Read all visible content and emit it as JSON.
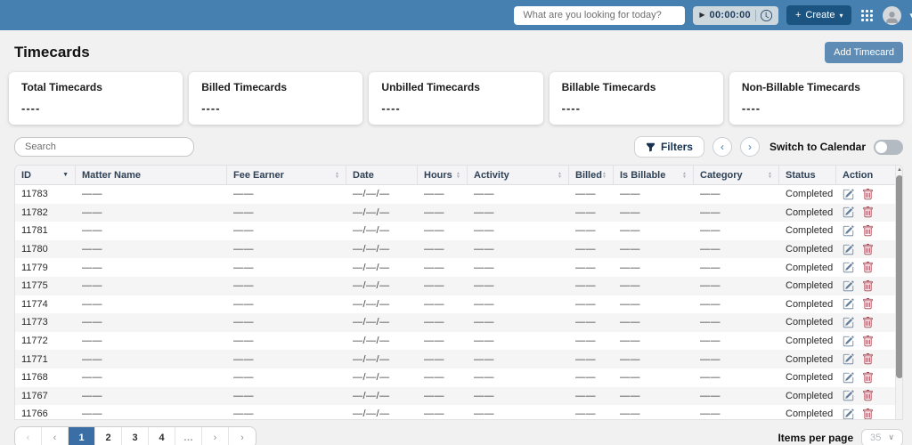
{
  "icons": {
    "plus": "+",
    "caret_down": "▾",
    "play": "▶",
    "chevron_left": "‹",
    "chevron_right": "›",
    "sort_caret": "▼",
    "sort_up": "▲",
    "sort_down": "▼",
    "select_caret": "∨",
    "scroll_up": "▲"
  },
  "colors": {
    "topbar": "#4580b0",
    "create_button": "#1b5480",
    "add_button": "#5e8cb4",
    "active_page": "#3a6ea5",
    "edit_icon": "#647f9c",
    "delete_icon": "#a83a48"
  },
  "topbar": {
    "search_placeholder": "What are you looking for today?",
    "timer_time": "00:00:00",
    "create_label": "Create"
  },
  "page": {
    "title": "Timecards",
    "add_button_label": "Add Timecard"
  },
  "summary_cards": [
    {
      "label": "Total Timecards",
      "value": "----"
    },
    {
      "label": "Billed Timecards",
      "value": "----"
    },
    {
      "label": "Unbilled Timecards",
      "value": "----"
    },
    {
      "label": "Billable Timecards",
      "value": "----"
    },
    {
      "label": "Non-Billable Timecards",
      "value": "----"
    }
  ],
  "filters": {
    "search_placeholder": "Search",
    "filters_label": "Filters",
    "calendar_toggle_label": "Switch to Calendar",
    "toggle_state": "off"
  },
  "table": {
    "columns": [
      {
        "label": "ID",
        "sort": "caret"
      },
      {
        "label": "Matter Name",
        "sort": "none"
      },
      {
        "label": "Fee Earner",
        "sort": "updown"
      },
      {
        "label": "Date",
        "sort": "none"
      },
      {
        "label": "Hours",
        "sort": "updown"
      },
      {
        "label": "Activity",
        "sort": "updown"
      },
      {
        "label": "Billed",
        "sort": "updown"
      },
      {
        "label": "Is Billable",
        "sort": "updown"
      },
      {
        "label": "Category",
        "sort": "updown"
      },
      {
        "label": "Status",
        "sort": "none"
      },
      {
        "label": "Action",
        "sort": "none"
      }
    ],
    "field_order": [
      "id",
      "matter_name",
      "fee_earner",
      "date",
      "hours",
      "activity",
      "billed",
      "is_billable",
      "category",
      "status"
    ],
    "rows": [
      {
        "id": "11783",
        "matter_name": "——",
        "fee_earner": "——",
        "date": "—/—/—",
        "hours": "——",
        "activity": "——",
        "billed": "——",
        "is_billable": "——",
        "category": "——",
        "status": "Completed"
      },
      {
        "id": "11782",
        "matter_name": "——",
        "fee_earner": "——",
        "date": "—/—/—",
        "hours": "——",
        "activity": "——",
        "billed": "——",
        "is_billable": "——",
        "category": "——",
        "status": "Completed"
      },
      {
        "id": "11781",
        "matter_name": "——",
        "fee_earner": "——",
        "date": "—/—/—",
        "hours": "——",
        "activity": "——",
        "billed": "——",
        "is_billable": "——",
        "category": "——",
        "status": "Completed"
      },
      {
        "id": "11780",
        "matter_name": "——",
        "fee_earner": "——",
        "date": "—/—/—",
        "hours": "——",
        "activity": "——",
        "billed": "——",
        "is_billable": "——",
        "category": "——",
        "status": "Completed"
      },
      {
        "id": "11779",
        "matter_name": "——",
        "fee_earner": "——",
        "date": "—/—/—",
        "hours": "——",
        "activity": "——",
        "billed": "——",
        "is_billable": "——",
        "category": "——",
        "status": "Completed"
      },
      {
        "id": "11775",
        "matter_name": "——",
        "fee_earner": "——",
        "date": "—/—/—",
        "hours": "——",
        "activity": "——",
        "billed": "——",
        "is_billable": "——",
        "category": "——",
        "status": "Completed"
      },
      {
        "id": "11774",
        "matter_name": "——",
        "fee_earner": "——",
        "date": "—/—/—",
        "hours": "——",
        "activity": "——",
        "billed": "——",
        "is_billable": "——",
        "category": "——",
        "status": "Completed"
      },
      {
        "id": "11773",
        "matter_name": "——",
        "fee_earner": "——",
        "date": "—/—/—",
        "hours": "——",
        "activity": "——",
        "billed": "——",
        "is_billable": "——",
        "category": "——",
        "status": "Completed"
      },
      {
        "id": "11772",
        "matter_name": "——",
        "fee_earner": "——",
        "date": "—/—/—",
        "hours": "——",
        "activity": "——",
        "billed": "——",
        "is_billable": "——",
        "category": "——",
        "status": "Completed"
      },
      {
        "id": "11771",
        "matter_name": "——",
        "fee_earner": "——",
        "date": "—/—/—",
        "hours": "——",
        "activity": "——",
        "billed": "——",
        "is_billable": "——",
        "category": "——",
        "status": "Completed"
      },
      {
        "id": "11768",
        "matter_name": "——",
        "fee_earner": "——",
        "date": "—/—/—",
        "hours": "——",
        "activity": "——",
        "billed": "——",
        "is_billable": "——",
        "category": "——",
        "status": "Completed"
      },
      {
        "id": "11767",
        "matter_name": "——",
        "fee_earner": "——",
        "date": "—/—/—",
        "hours": "——",
        "activity": "——",
        "billed": "——",
        "is_billable": "——",
        "category": "——",
        "status": "Completed"
      },
      {
        "id": "11766",
        "matter_name": "——",
        "fee_earner": "——",
        "date": "—/—/—",
        "hours": "——",
        "activity": "——",
        "billed": "——",
        "is_billable": "——",
        "category": "——",
        "status": "Completed"
      }
    ]
  },
  "pagination": {
    "items": [
      {
        "label": "‹",
        "kind": "nav",
        "name": "first-page-button",
        "state": "disabled"
      },
      {
        "label": "‹",
        "kind": "nav",
        "name": "prev-page-button",
        "state": "normal"
      },
      {
        "label": "1",
        "kind": "page",
        "name": "page-1-button",
        "state": "active"
      },
      {
        "label": "2",
        "kind": "page",
        "name": "page-2-button",
        "state": "normal"
      },
      {
        "label": "3",
        "kind": "page",
        "name": "page-3-button",
        "state": "normal"
      },
      {
        "label": "4",
        "kind": "page",
        "name": "page-4-button",
        "state": "normal"
      },
      {
        "label": "…",
        "kind": "ellipsis",
        "name": "page-ellipsis",
        "state": "normal"
      },
      {
        "label": "›",
        "kind": "nav",
        "name": "next-page-button",
        "state": "normal"
      },
      {
        "label": "›",
        "kind": "nav",
        "name": "last-page-button",
        "state": "normal"
      }
    ],
    "items_per_page_label": "Items per page",
    "items_per_page_value": "35"
  }
}
